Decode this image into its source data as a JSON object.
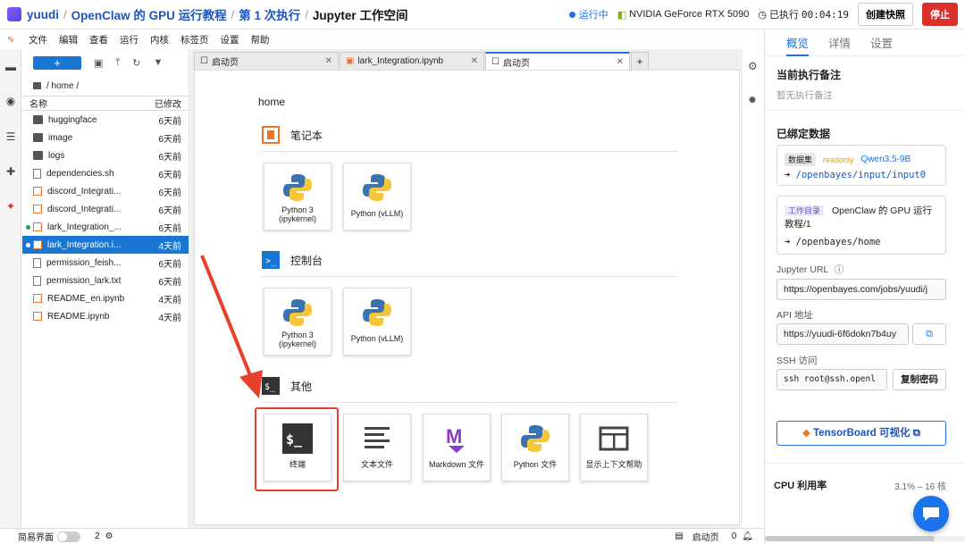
{
  "header": {
    "user": "yuudi",
    "project": "OpenClaw 的 GPU 运行教程",
    "run": "第 1 次执行",
    "workspace": "Jupyter 工作空间",
    "status": "运行中",
    "gpu": "NVIDIA GeForce RTX 5090",
    "elapsed_label": "已执行",
    "elapsed": "00:04:19",
    "snapshot_button": "创建快照",
    "stop_button": "停止"
  },
  "menu": [
    "文件",
    "编辑",
    "查看",
    "运行",
    "内核",
    "标签页",
    "设置",
    "帮助"
  ],
  "filebrowser": {
    "new_label": "+",
    "path": "/ home /",
    "col_name": "名称",
    "col_modified": "已修改",
    "files": [
      {
        "name": "huggingface",
        "mod": "6天前",
        "type": "folder"
      },
      {
        "name": "image",
        "mod": "6天前",
        "type": "folder"
      },
      {
        "name": "logs",
        "mod": "6天前",
        "type": "folder"
      },
      {
        "name": "dependencies.sh",
        "mod": "6天前",
        "type": "file"
      },
      {
        "name": "discord_Integrati...",
        "mod": "6天前",
        "type": "nb"
      },
      {
        "name": "discord_Integrati...",
        "mod": "6天前",
        "type": "nb"
      },
      {
        "name": "lark_Integration_...",
        "mod": "6天前",
        "type": "nb"
      },
      {
        "name": "lark_Integration.i...",
        "mod": "4天前",
        "type": "nb"
      },
      {
        "name": "permission_feish...",
        "mod": "6天前",
        "type": "file"
      },
      {
        "name": "permission_lark.txt",
        "mod": "6天前",
        "type": "file"
      },
      {
        "name": "README_en.ipynb",
        "mod": "4天前",
        "type": "nb"
      },
      {
        "name": "README.ipynb",
        "mod": "4天前",
        "type": "nb"
      }
    ]
  },
  "tabs": [
    {
      "label": "启动页"
    },
    {
      "label": "lark_Integration.ipynb"
    },
    {
      "label": "启动页"
    }
  ],
  "launcher": {
    "path": "home",
    "notebook": "笔记本",
    "console": "控制台",
    "other": "其他",
    "kernels": [
      {
        "l1": "Python 3",
        "l2": "(ipykernel)"
      },
      {
        "l1": "Python (vLLM)",
        "l2": ""
      }
    ],
    "others": [
      "终端",
      "文本文件",
      "Markdown 文件",
      "Python 文件",
      "显示上下文帮助"
    ]
  },
  "right": {
    "tabs": [
      "概览",
      "详情",
      "设置"
    ],
    "note_title": "当前执行备注",
    "note_empty": "暂无执行备注",
    "bound_title": "已绑定数据",
    "ds_tag": "数据集",
    "ds_ro": "readonly",
    "ds_name": "Qwen3.5-9B",
    "ds_path": "/openbayes/input/input0",
    "wd_tag": "工作目录",
    "wd_name": "OpenClaw 的 GPU 运行教程/1",
    "wd_path": "/openbayes/home",
    "jupyter_label": "Jupyter URL",
    "jupyter_url": "https://openbayes.com/jobs/yuudi/j",
    "api_label": "API 地址",
    "api_url": "https://yuudi-6f6dokn7b4uy",
    "ssh_label": "SSH 访问",
    "ssh_cmd": "ssh root@ssh.openl",
    "copy_pw": "复制密码",
    "tensorboard": "TensorBoard 可视化",
    "cpu_label": "CPU 利用率",
    "cpu_val": "3.1% – 16 核"
  },
  "statusbar": {
    "mode": "简易界面",
    "count": "2",
    "tab": "启动页",
    "num": "0"
  },
  "colors": {
    "accent": "#1976d2",
    "highlight": "#e8402a"
  }
}
